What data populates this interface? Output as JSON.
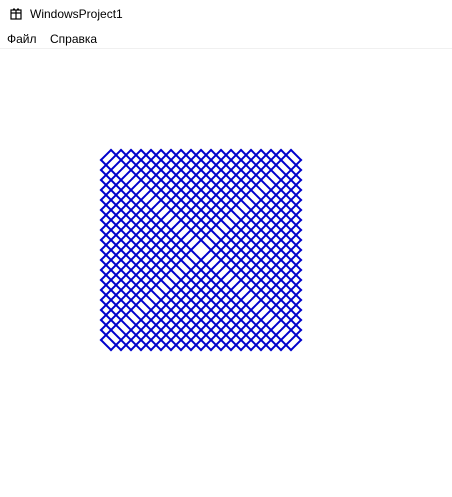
{
  "window": {
    "title": "WindowsProject1",
    "icon": "app-window-icon"
  },
  "menu": {
    "items": [
      {
        "label": "Файл"
      },
      {
        "label": "Справка"
      }
    ]
  },
  "canvas": {
    "stroke_color": "#0000cc",
    "background_color": "#ffffff"
  }
}
